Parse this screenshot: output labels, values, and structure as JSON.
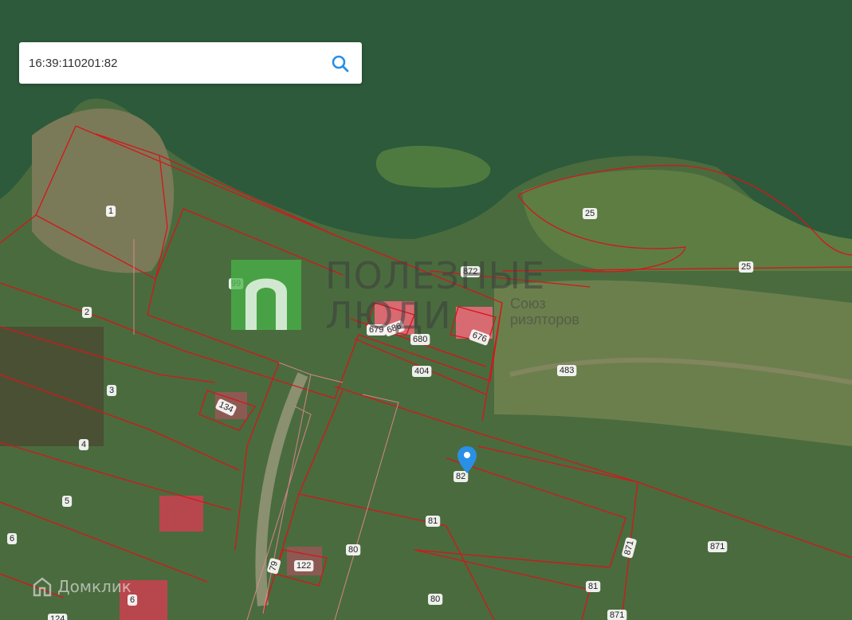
{
  "search": {
    "query": "16:39:110201:82"
  },
  "watermark": {
    "title": "ПОЛЕЗНЫЕ\nЛЮДИ",
    "subtitle": "Союз\nриэлторов"
  },
  "brand": {
    "name": "Домклик"
  },
  "map": {
    "selected_parcel": "82",
    "marker_color": "#2a8fe6",
    "boundary_color": "#d4161c",
    "labels": {
      "p1": "1",
      "p2": "2",
      "p3": "3",
      "p4": "4",
      "p5": "5",
      "p6a": "6",
      "p6b": "6",
      "p25a": "25",
      "p25b": "25",
      "p99": "99",
      "p872": "872",
      "p679": "679",
      "p686": "686",
      "p680": "680",
      "p676": "676",
      "p404": "404",
      "p483": "483",
      "p134": "134",
      "p82": "82",
      "p81a": "81",
      "p81b": "81",
      "p80a": "80",
      "p80b": "80",
      "p79": "79",
      "p122": "122",
      "p871a": "871",
      "p871b": "871",
      "p871c": "871",
      "p124": "124"
    }
  }
}
